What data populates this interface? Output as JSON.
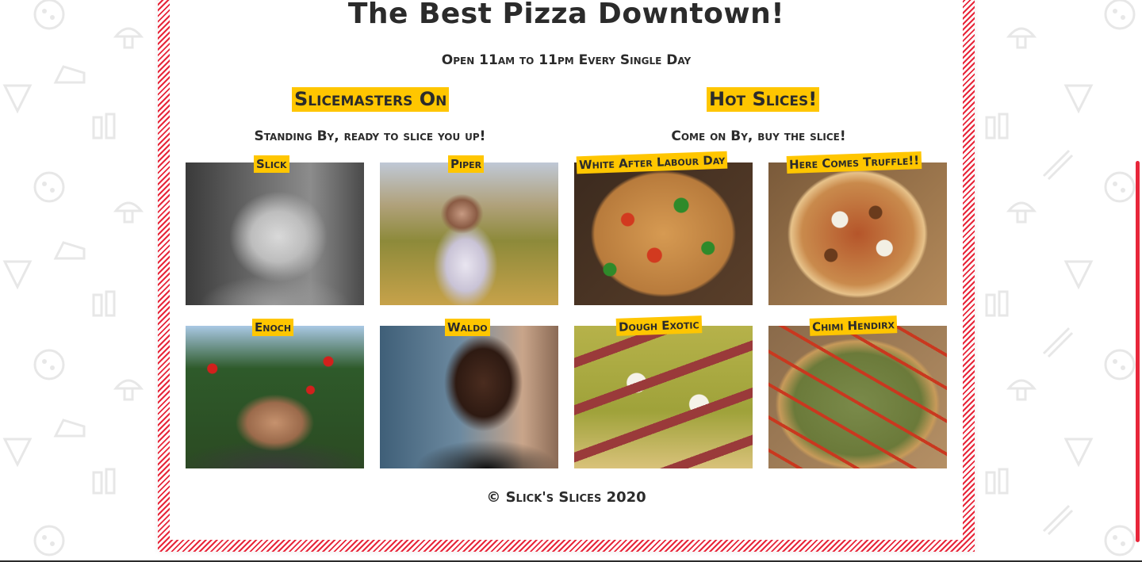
{
  "headline": "The Best Pizza Downtown!",
  "hours": "Open 11am to 11pm Every Single Day",
  "slicemasters": {
    "title": "Slicemasters On",
    "subtitle": "Standing By, ready to slice you up!",
    "people": [
      {
        "name": "Slick"
      },
      {
        "name": "Piper"
      },
      {
        "name": "Enoch"
      },
      {
        "name": "Waldo"
      }
    ]
  },
  "hot_slices": {
    "title": "Hot Slices!",
    "subtitle": "Come on By, buy the slice!",
    "pizzas": [
      {
        "name": "White After Labour Day"
      },
      {
        "name": "Here Comes Truffle!!"
      },
      {
        "name": "Dough Exotic"
      },
      {
        "name": "Chimi Hendirx"
      }
    ]
  },
  "footer": "© Slick's Slices 2020",
  "colors": {
    "accent_red": "#e8263a",
    "highlight_yellow": "#ffc600",
    "text_dark": "#2b2b2b"
  },
  "icons": [
    "pizza-icon",
    "mushroom-icon",
    "cheese-icon",
    "slice-icon",
    "bottles-icon",
    "bacon-icon"
  ]
}
